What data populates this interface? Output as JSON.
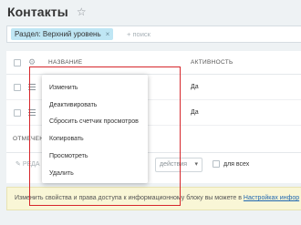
{
  "header": {
    "title": "Контакты",
    "favorite_icon": "star-icon"
  },
  "filter": {
    "chip_label": "Раздел: Верхний уровень",
    "chip_close": "×",
    "search_placeholder": "+ поиск"
  },
  "grid": {
    "columns": {
      "name": "НАЗВАНИЕ",
      "activity": "АКТИВНОСТЬ"
    },
    "rows": [
      {
        "activity": "Да"
      },
      {
        "activity": "Да"
      }
    ],
    "footer_label": "ОТМЕЧЕН",
    "action_bar": {
      "edit_label": "РЕДА",
      "action_select": "действия",
      "for_all_label": "для всех"
    }
  },
  "context_menu": {
    "items": [
      "Изменить",
      "Деактивировать",
      "Сбросить счетчик просмотров",
      "Копировать",
      "Просмотреть",
      "Удалить"
    ]
  },
  "info_bar": {
    "text": "Изменить свойства и права доступа к информационному блоку вы можете в",
    "link": "Настройках инфор"
  },
  "colors": {
    "page_bg": "#eef2f4",
    "chip_bg": "#bfe6f4",
    "info_bg": "#f9f6d6",
    "highlight": "#d6262b",
    "link": "#2067b0"
  }
}
